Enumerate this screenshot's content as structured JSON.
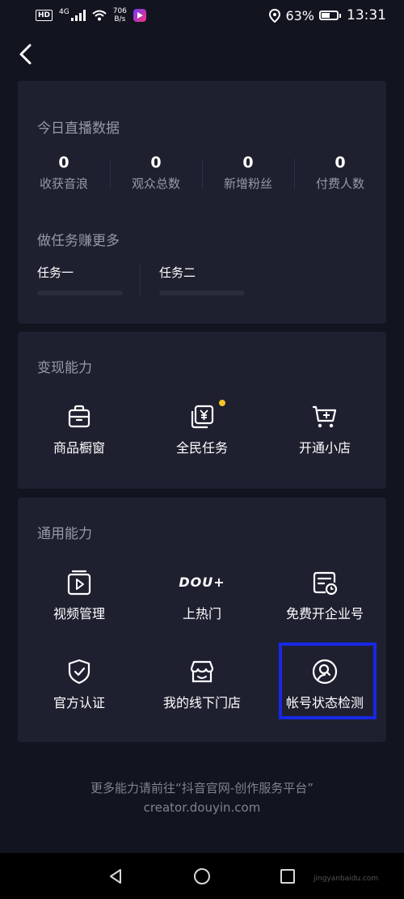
{
  "status_bar": {
    "network_badge": "HD",
    "network_type": "4G",
    "speed_value": "706",
    "speed_unit": "B/s",
    "battery_percent": "63%",
    "battery_level": 0.63,
    "time": "13:31"
  },
  "live_data": {
    "title": "今日直播数据",
    "stats": [
      {
        "value": "0",
        "label": "收获音浪"
      },
      {
        "value": "0",
        "label": "观众总数"
      },
      {
        "value": "0",
        "label": "新增粉丝"
      },
      {
        "value": "0",
        "label": "付费人数"
      }
    ],
    "tasks_title": "做任务赚更多",
    "tasks": [
      {
        "label": "任务一"
      },
      {
        "label": "任务二"
      }
    ]
  },
  "monetization": {
    "title": "变现能力",
    "items": [
      {
        "label": "商品橱窗",
        "icon": "shop-window-icon"
      },
      {
        "label": "全民任务",
        "icon": "task-yuan-icon",
        "badge_dot": true
      },
      {
        "label": "开通小店",
        "icon": "cart-add-icon"
      }
    ]
  },
  "general": {
    "title": "通用能力",
    "items": [
      {
        "label": "视频管理",
        "icon": "video-manage-icon"
      },
      {
        "label": "上热门",
        "icon": "dou-plus-logo",
        "logo_text": "DOU+"
      },
      {
        "label": "免费开企业号",
        "icon": "enterprise-clock-icon"
      },
      {
        "label": "官方认证",
        "icon": "shield-check-icon"
      },
      {
        "label": "我的线下门店",
        "icon": "store-icon"
      },
      {
        "label": "帐号状态检测",
        "icon": "user-search-icon",
        "highlighted": true
      }
    ]
  },
  "footer": {
    "line1": "更多能力请前往“抖音官网-创作服务平台”",
    "line2": "creator.douyin.com"
  },
  "watermark": "jingyanbaidu.com",
  "colors": {
    "background": "#121420",
    "card": "#1e2030",
    "highlight": "#1728e6",
    "badge_dot": "#f5c32a",
    "muted_text": "#9698a6"
  }
}
